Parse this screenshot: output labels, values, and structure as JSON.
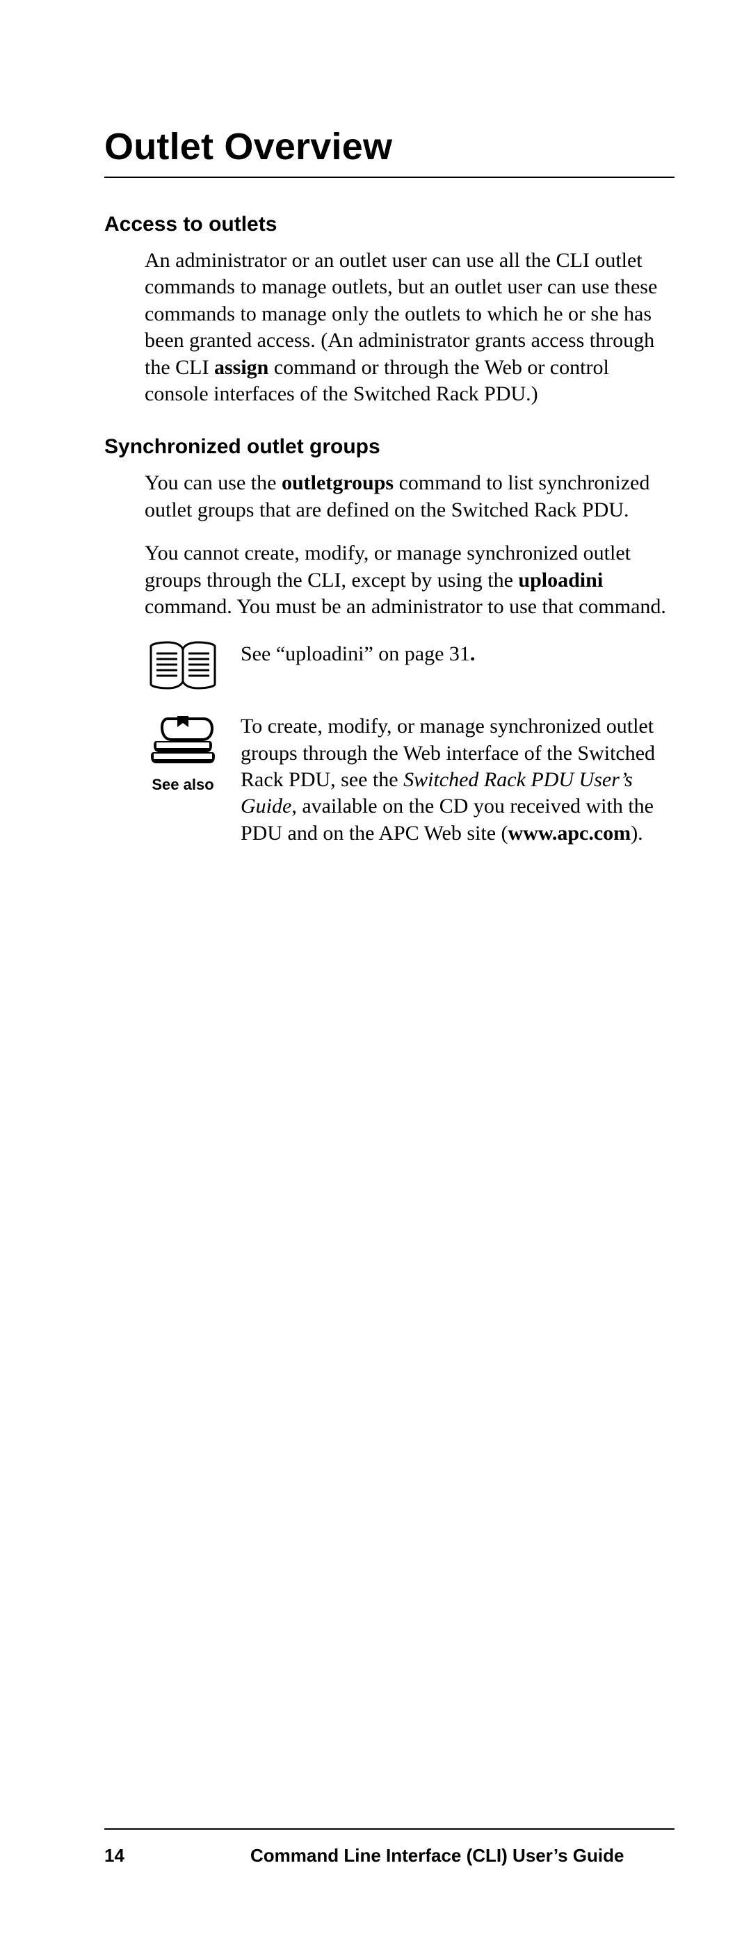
{
  "title": "Outlet Overview",
  "sections": {
    "access": {
      "heading": "Access to outlets",
      "p1a": "An administrator or an outlet user can use all the CLI outlet commands to manage outlets, but an outlet user can use these commands to manage only the outlets to which he or she has been granted access. (An administrator grants access through the CLI ",
      "p1cmd": "assign",
      "p1b": " command or through the Web or control console interfaces of the Switched Rack PDU.)"
    },
    "sync": {
      "heading": "Synchronized outlet groups",
      "p1a": "You can use the ",
      "p1cmd": "outletgroups",
      "p1b": " command to list synchronized outlet groups that are defined on the Switched Rack PDU.",
      "p2a": "You cannot create, modify, or manage synchronized outlet groups through the CLI, except by using the ",
      "p2cmd": "uploadini",
      "p2b": " command. You must be an administrator to use that command."
    }
  },
  "callouts": {
    "see": {
      "texta": "See “uploadini” on page 31",
      "dot": "."
    },
    "seealso": {
      "label": "See also",
      "t1": "To create, modify, or manage synchronized outlet groups through the Web interface of the Switched Rack PDU, see the ",
      "t2": "Switched Rack PDU User’s Guide",
      "t3": ", available on the CD you received with the PDU and on the APC Web site (",
      "t4": "www.apc.com",
      "t5": ")."
    }
  },
  "footer": {
    "page": "14",
    "doc": "Command Line Interface (CLI) User’s Guide"
  }
}
